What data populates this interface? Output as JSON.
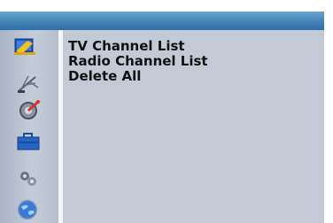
{
  "menu": {
    "items": [
      {
        "label": "TV Channel List"
      },
      {
        "label": "Radio Channel List"
      },
      {
        "label": "Delete All"
      }
    ]
  },
  "sidebar": {
    "icons": [
      {
        "name": "tv-icon"
      },
      {
        "name": "antenna-icon"
      },
      {
        "name": "settings-icon"
      },
      {
        "name": "toolbox-icon"
      },
      {
        "name": "media-icon"
      },
      {
        "name": "globe-icon"
      }
    ]
  },
  "colors": {
    "titlebar": "#3f7fb6",
    "content": "#c3cad6",
    "sidebar": "#b7bfce",
    "text": "#111111"
  }
}
